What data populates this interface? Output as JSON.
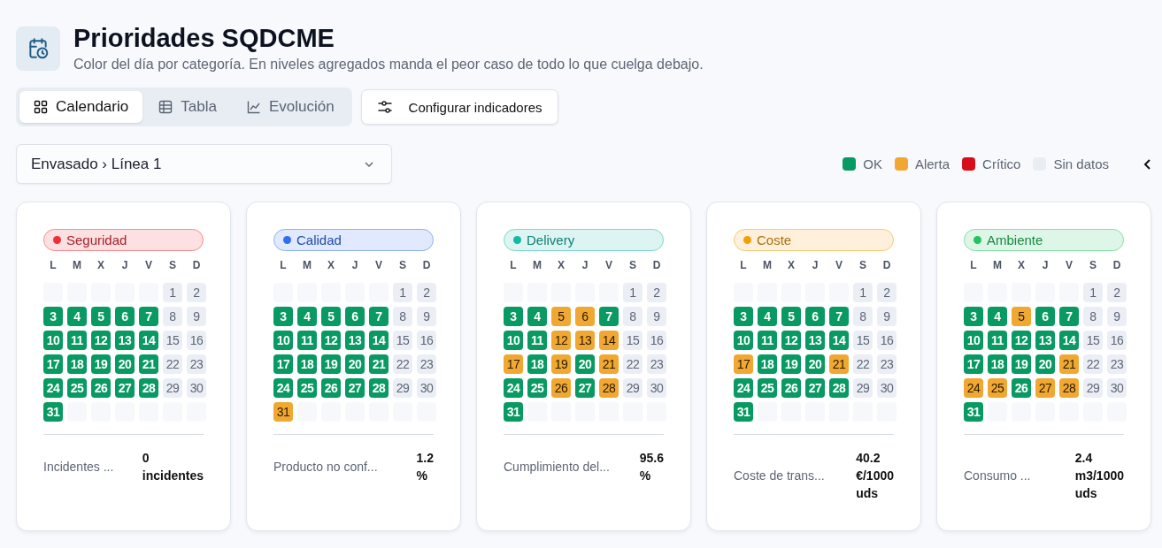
{
  "header": {
    "title": "Prioridades SQDCME",
    "subtitle": "Color del día por categoría. En niveles agregados manda el peor caso de todo lo que cuelga debajo."
  },
  "tabs": [
    {
      "label": "Calendario",
      "selected": true
    },
    {
      "label": "Tabla",
      "selected": false
    },
    {
      "label": "Evolución",
      "selected": false
    }
  ],
  "config_button": {
    "label": "Configurar indicadores"
  },
  "scope_select": {
    "value": "Envasado › Línea 1"
  },
  "legend": [
    {
      "label": "OK",
      "color": "#089a62"
    },
    {
      "label": "Alerta",
      "color": "#f0a832"
    },
    {
      "label": "Crítico",
      "color": "#d60d1a"
    },
    {
      "label": "Sin datos",
      "color": "#e9eef5"
    }
  ],
  "cards": [
    {
      "category": "Seguridad",
      "color": "#ef2f3a",
      "weekdays": [
        "L",
        "M",
        "X",
        "J",
        "V",
        "S",
        "D"
      ],
      "days": [
        {
          "kind": "blank"
        },
        {
          "kind": "blank"
        },
        {
          "kind": "blank"
        },
        {
          "kind": "blank"
        },
        {
          "kind": "blank"
        },
        {
          "day": "1",
          "kind": "none"
        },
        {
          "day": "2",
          "kind": "none"
        },
        {
          "day": "3",
          "kind": "ok"
        },
        {
          "day": "4",
          "kind": "ok"
        },
        {
          "day": "5",
          "kind": "ok"
        },
        {
          "day": "6",
          "kind": "ok"
        },
        {
          "day": "7",
          "kind": "ok"
        },
        {
          "day": "8",
          "kind": "none"
        },
        {
          "day": "9",
          "kind": "none"
        },
        {
          "day": "10",
          "kind": "ok"
        },
        {
          "day": "11",
          "kind": "ok"
        },
        {
          "day": "12",
          "kind": "ok"
        },
        {
          "day": "13",
          "kind": "ok"
        },
        {
          "day": "14",
          "kind": "ok"
        },
        {
          "day": "15",
          "kind": "none"
        },
        {
          "day": "16",
          "kind": "none"
        },
        {
          "day": "17",
          "kind": "ok"
        },
        {
          "day": "18",
          "kind": "ok"
        },
        {
          "day": "19",
          "kind": "ok"
        },
        {
          "day": "20",
          "kind": "ok"
        },
        {
          "day": "21",
          "kind": "ok"
        },
        {
          "day": "22",
          "kind": "none"
        },
        {
          "day": "23",
          "kind": "none"
        },
        {
          "day": "24",
          "kind": "ok"
        },
        {
          "day": "25",
          "kind": "ok"
        },
        {
          "day": "26",
          "kind": "ok"
        },
        {
          "day": "27",
          "kind": "ok"
        },
        {
          "day": "28",
          "kind": "ok"
        },
        {
          "day": "29",
          "kind": "none"
        },
        {
          "day": "30",
          "kind": "none"
        },
        {
          "day": "31",
          "kind": "ok"
        },
        {
          "kind": "blank"
        },
        {
          "kind": "blank"
        },
        {
          "kind": "blank"
        },
        {
          "kind": "blank"
        },
        {
          "kind": "blank"
        },
        {
          "kind": "blank"
        }
      ],
      "metric_label": "Incidentes ...",
      "metric_value": "0 incidentes"
    },
    {
      "category": "Calidad",
      "color": "#2f6ff0",
      "weekdays": [
        "L",
        "M",
        "X",
        "J",
        "V",
        "S",
        "D"
      ],
      "days": [
        {
          "kind": "blank"
        },
        {
          "kind": "blank"
        },
        {
          "kind": "blank"
        },
        {
          "kind": "blank"
        },
        {
          "kind": "blank"
        },
        {
          "day": "1",
          "kind": "none"
        },
        {
          "day": "2",
          "kind": "none"
        },
        {
          "day": "3",
          "kind": "ok"
        },
        {
          "day": "4",
          "kind": "ok"
        },
        {
          "day": "5",
          "kind": "ok"
        },
        {
          "day": "6",
          "kind": "ok"
        },
        {
          "day": "7",
          "kind": "ok"
        },
        {
          "day": "8",
          "kind": "none"
        },
        {
          "day": "9",
          "kind": "none"
        },
        {
          "day": "10",
          "kind": "ok"
        },
        {
          "day": "11",
          "kind": "ok"
        },
        {
          "day": "12",
          "kind": "ok"
        },
        {
          "day": "13",
          "kind": "ok"
        },
        {
          "day": "14",
          "kind": "ok"
        },
        {
          "day": "15",
          "kind": "none"
        },
        {
          "day": "16",
          "kind": "none"
        },
        {
          "day": "17",
          "kind": "ok"
        },
        {
          "day": "18",
          "kind": "ok"
        },
        {
          "day": "19",
          "kind": "ok"
        },
        {
          "day": "20",
          "kind": "ok"
        },
        {
          "day": "21",
          "kind": "ok"
        },
        {
          "day": "22",
          "kind": "none"
        },
        {
          "day": "23",
          "kind": "none"
        },
        {
          "day": "24",
          "kind": "ok"
        },
        {
          "day": "25",
          "kind": "ok"
        },
        {
          "day": "26",
          "kind": "ok"
        },
        {
          "day": "27",
          "kind": "ok"
        },
        {
          "day": "28",
          "kind": "ok"
        },
        {
          "day": "29",
          "kind": "none"
        },
        {
          "day": "30",
          "kind": "none"
        },
        {
          "day": "31",
          "kind": "alerta"
        },
        {
          "kind": "blank"
        },
        {
          "kind": "blank"
        },
        {
          "kind": "blank"
        },
        {
          "kind": "blank"
        },
        {
          "kind": "blank"
        },
        {
          "kind": "blank"
        }
      ],
      "metric_label": "Producto no conf...",
      "metric_value": "1.2 %"
    },
    {
      "category": "Delivery",
      "color": "#14b8a6",
      "weekdays": [
        "L",
        "M",
        "X",
        "J",
        "V",
        "S",
        "D"
      ],
      "days": [
        {
          "kind": "blank"
        },
        {
          "kind": "blank"
        },
        {
          "kind": "blank"
        },
        {
          "kind": "blank"
        },
        {
          "kind": "blank"
        },
        {
          "day": "1",
          "kind": "none"
        },
        {
          "day": "2",
          "kind": "none"
        },
        {
          "day": "3",
          "kind": "ok"
        },
        {
          "day": "4",
          "kind": "ok"
        },
        {
          "day": "5",
          "kind": "alerta"
        },
        {
          "day": "6",
          "kind": "alerta"
        },
        {
          "day": "7",
          "kind": "ok"
        },
        {
          "day": "8",
          "kind": "none"
        },
        {
          "day": "9",
          "kind": "none"
        },
        {
          "day": "10",
          "kind": "ok"
        },
        {
          "day": "11",
          "kind": "ok"
        },
        {
          "day": "12",
          "kind": "alerta"
        },
        {
          "day": "13",
          "kind": "alerta"
        },
        {
          "day": "14",
          "kind": "alerta"
        },
        {
          "day": "15",
          "kind": "none"
        },
        {
          "day": "16",
          "kind": "none"
        },
        {
          "day": "17",
          "kind": "alerta"
        },
        {
          "day": "18",
          "kind": "ok"
        },
        {
          "day": "19",
          "kind": "alerta"
        },
        {
          "day": "20",
          "kind": "ok"
        },
        {
          "day": "21",
          "kind": "alerta"
        },
        {
          "day": "22",
          "kind": "none"
        },
        {
          "day": "23",
          "kind": "none"
        },
        {
          "day": "24",
          "kind": "ok"
        },
        {
          "day": "25",
          "kind": "ok"
        },
        {
          "day": "26",
          "kind": "alerta"
        },
        {
          "day": "27",
          "kind": "ok"
        },
        {
          "day": "28",
          "kind": "alerta"
        },
        {
          "day": "29",
          "kind": "none"
        },
        {
          "day": "30",
          "kind": "none"
        },
        {
          "day": "31",
          "kind": "ok"
        },
        {
          "kind": "blank"
        },
        {
          "kind": "blank"
        },
        {
          "kind": "blank"
        },
        {
          "kind": "blank"
        },
        {
          "kind": "blank"
        },
        {
          "kind": "blank"
        }
      ],
      "metric_label": "Cumplimiento del...",
      "metric_value": "95.6 %"
    },
    {
      "category": "Coste",
      "color": "#f59e0b",
      "weekdays": [
        "L",
        "M",
        "X",
        "J",
        "V",
        "S",
        "D"
      ],
      "days": [
        {
          "kind": "blank"
        },
        {
          "kind": "blank"
        },
        {
          "kind": "blank"
        },
        {
          "kind": "blank"
        },
        {
          "kind": "blank"
        },
        {
          "day": "1",
          "kind": "none"
        },
        {
          "day": "2",
          "kind": "none"
        },
        {
          "day": "3",
          "kind": "ok"
        },
        {
          "day": "4",
          "kind": "ok"
        },
        {
          "day": "5",
          "kind": "ok"
        },
        {
          "day": "6",
          "kind": "ok"
        },
        {
          "day": "7",
          "kind": "ok"
        },
        {
          "day": "8",
          "kind": "none"
        },
        {
          "day": "9",
          "kind": "none"
        },
        {
          "day": "10",
          "kind": "ok"
        },
        {
          "day": "11",
          "kind": "ok"
        },
        {
          "day": "12",
          "kind": "ok"
        },
        {
          "day": "13",
          "kind": "ok"
        },
        {
          "day": "14",
          "kind": "ok"
        },
        {
          "day": "15",
          "kind": "none"
        },
        {
          "day": "16",
          "kind": "none"
        },
        {
          "day": "17",
          "kind": "alerta"
        },
        {
          "day": "18",
          "kind": "ok"
        },
        {
          "day": "19",
          "kind": "ok"
        },
        {
          "day": "20",
          "kind": "ok"
        },
        {
          "day": "21",
          "kind": "alerta"
        },
        {
          "day": "22",
          "kind": "none"
        },
        {
          "day": "23",
          "kind": "none"
        },
        {
          "day": "24",
          "kind": "ok"
        },
        {
          "day": "25",
          "kind": "ok"
        },
        {
          "day": "26",
          "kind": "ok"
        },
        {
          "day": "27",
          "kind": "ok"
        },
        {
          "day": "28",
          "kind": "ok"
        },
        {
          "day": "29",
          "kind": "none"
        },
        {
          "day": "30",
          "kind": "none"
        },
        {
          "day": "31",
          "kind": "ok"
        },
        {
          "kind": "blank"
        },
        {
          "kind": "blank"
        },
        {
          "kind": "blank"
        },
        {
          "kind": "blank"
        },
        {
          "kind": "blank"
        },
        {
          "kind": "blank"
        }
      ],
      "metric_label": "Coste de trans...",
      "metric_value": "40.2 €/1000 uds"
    },
    {
      "category": "Ambiente",
      "color": "#22c55e",
      "weekdays": [
        "L",
        "M",
        "X",
        "J",
        "V",
        "S",
        "D"
      ],
      "days": [
        {
          "kind": "blank"
        },
        {
          "kind": "blank"
        },
        {
          "kind": "blank"
        },
        {
          "kind": "blank"
        },
        {
          "kind": "blank"
        },
        {
          "day": "1",
          "kind": "none"
        },
        {
          "day": "2",
          "kind": "none"
        },
        {
          "day": "3",
          "kind": "ok"
        },
        {
          "day": "4",
          "kind": "ok"
        },
        {
          "day": "5",
          "kind": "alerta"
        },
        {
          "day": "6",
          "kind": "ok"
        },
        {
          "day": "7",
          "kind": "ok"
        },
        {
          "day": "8",
          "kind": "none"
        },
        {
          "day": "9",
          "kind": "none"
        },
        {
          "day": "10",
          "kind": "ok"
        },
        {
          "day": "11",
          "kind": "ok"
        },
        {
          "day": "12",
          "kind": "ok"
        },
        {
          "day": "13",
          "kind": "ok"
        },
        {
          "day": "14",
          "kind": "ok"
        },
        {
          "day": "15",
          "kind": "none"
        },
        {
          "day": "16",
          "kind": "none"
        },
        {
          "day": "17",
          "kind": "ok"
        },
        {
          "day": "18",
          "kind": "ok"
        },
        {
          "day": "19",
          "kind": "ok"
        },
        {
          "day": "20",
          "kind": "ok"
        },
        {
          "day": "21",
          "kind": "alerta"
        },
        {
          "day": "22",
          "kind": "none"
        },
        {
          "day": "23",
          "kind": "none"
        },
        {
          "day": "24",
          "kind": "alerta"
        },
        {
          "day": "25",
          "kind": "alerta"
        },
        {
          "day": "26",
          "kind": "ok"
        },
        {
          "day": "27",
          "kind": "alerta"
        },
        {
          "day": "28",
          "kind": "alerta"
        },
        {
          "day": "29",
          "kind": "none"
        },
        {
          "day": "30",
          "kind": "none"
        },
        {
          "day": "31",
          "kind": "ok"
        },
        {
          "kind": "blank"
        },
        {
          "kind": "blank"
        },
        {
          "kind": "blank"
        },
        {
          "kind": "blank"
        },
        {
          "kind": "blank"
        },
        {
          "kind": "blank"
        }
      ],
      "metric_label": "Consumo ...",
      "metric_value": "2.4 m3/1000 uds"
    }
  ]
}
